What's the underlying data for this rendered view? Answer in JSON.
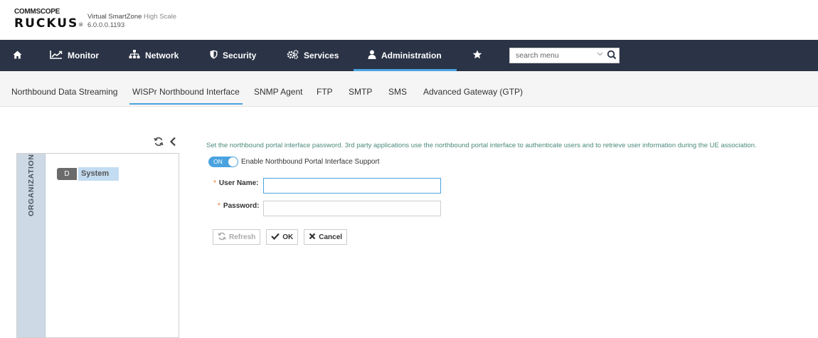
{
  "header": {
    "brand_top": "COMMSCOPE",
    "brand_main": "RUCKUS",
    "brand_mark": "®",
    "product_name": "Virtual SmartZone",
    "product_tier": "High Scale",
    "version": "6.0.0.0.1193"
  },
  "topnav": {
    "items": [
      {
        "label": "Monitor",
        "icon": "chart-line-icon"
      },
      {
        "label": "Network",
        "icon": "network-icon"
      },
      {
        "label": "Security",
        "icon": "shield-icon"
      },
      {
        "label": "Services",
        "icon": "cogs-icon"
      },
      {
        "label": "Administration",
        "icon": "user-icon"
      }
    ],
    "active": "Administration",
    "search_placeholder": "search menu"
  },
  "subnav": {
    "items": [
      "Northbound Data Streaming",
      "WISPr Northbound Interface",
      "SNMP Agent",
      "FTP",
      "SMTP",
      "SMS",
      "Advanced Gateway (GTP)"
    ],
    "active": "WISPr Northbound Interface"
  },
  "left_panel": {
    "tab_label": "ORGANIZATION",
    "node_badge": "D",
    "node_label": "System"
  },
  "content": {
    "description": "Set the northbound portal interface password. 3rd party applications use the northbound portal interface to authenticate users and to retrieve user information during the UE association.",
    "toggle_state": "ON",
    "toggle_label": "Enable Northbound Portal Interface Support",
    "username_label": "User Name:",
    "username_value": "",
    "password_label": "Password:",
    "password_value": "",
    "required_mark": "*",
    "buttons": {
      "refresh": "Refresh",
      "ok": "OK",
      "cancel": "Cancel"
    }
  },
  "colors": {
    "nav_bg": "#2b3346",
    "accent": "#4aa3df",
    "description_text": "#4a8a7a",
    "required": "#e57a2e"
  }
}
